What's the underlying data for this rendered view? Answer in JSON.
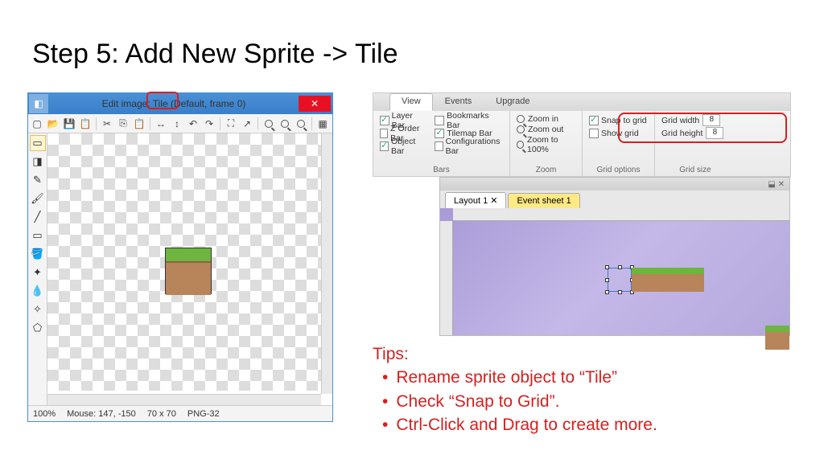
{
  "slide": {
    "title": "Step 5: Add New Sprite -> Tile"
  },
  "editor": {
    "title": "Edit image: Tile (Default, frame 0)",
    "close": "✕",
    "status": {
      "zoom": "100%",
      "mouse": "Mouse: 147, -150",
      "size": "70 x 70",
      "format": "PNG-32"
    }
  },
  "ribbon": {
    "tabs": {
      "view": "View",
      "events": "Events",
      "upgrade": "Upgrade"
    },
    "bars": {
      "layer": "Layer Bar",
      "zorder": "Z Order Bar",
      "object": "Object Bar",
      "bookmarks": "Bookmarks Bar",
      "tilemap": "Tilemap Bar",
      "config": "Configurations Bar",
      "label": "Bars"
    },
    "zoom": {
      "in": "Zoom in",
      "out": "Zoom out",
      "reset": "Zoom to 100%",
      "label": "Zoom"
    },
    "grid_opt": {
      "snap": "Snap to grid",
      "show": "Show grid",
      "label": "Grid options"
    },
    "grid_size": {
      "w_label": "Grid width",
      "w": "8",
      "h_label": "Grid height",
      "h": "8",
      "label": "Grid size"
    }
  },
  "layout": {
    "pin": "⬓ ✕",
    "tab1": "Layout 1",
    "tab1x": "✕",
    "tab2": "Event sheet 1"
  },
  "tips": {
    "heading": "Tips:",
    "t1": "Rename sprite object to “Tile”",
    "t2": "Check “Snap to Grid”.",
    "t3": "Ctrl-Click and Drag to create more."
  }
}
